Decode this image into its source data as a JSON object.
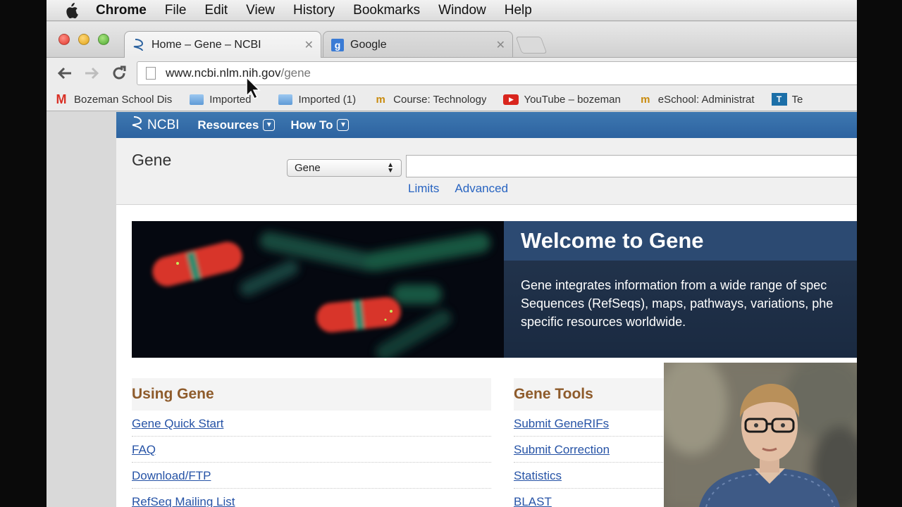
{
  "menubar": {
    "app_name": "Chrome",
    "items": [
      "File",
      "Edit",
      "View",
      "History",
      "Bookmarks",
      "Window",
      "Help"
    ]
  },
  "tabs": [
    {
      "title": "Home – Gene – NCBI",
      "icon": "ncbi-helix-icon",
      "active": true
    },
    {
      "title": "Google",
      "icon": "google-icon",
      "active": false
    }
  ],
  "omnibox": {
    "host": "www.ncbi.nlm.nih.gov",
    "path": "/gene"
  },
  "bookmarks": [
    {
      "label": "Bozeman School Dis",
      "icon": "gmail-icon"
    },
    {
      "label": "Imported",
      "icon": "folder-icon"
    },
    {
      "label": "Imported (1)",
      "icon": "folder-icon"
    },
    {
      "label": "Course: Technology",
      "icon": "course-icon"
    },
    {
      "label": "YouTube – bozeman",
      "icon": "youtube-icon"
    },
    {
      "label": "eSchool: Administrat",
      "icon": "course-icon"
    },
    {
      "label": "Te",
      "icon": "te-icon"
    }
  ],
  "ncbi": {
    "logo": "NCBI",
    "menus": [
      "Resources",
      "How To"
    ]
  },
  "search": {
    "db_title": "Gene",
    "db_selected": "Gene",
    "links": [
      "Limits",
      "Advanced"
    ]
  },
  "hero": {
    "title": "Welcome to Gene",
    "lines": [
      "Gene integrates information from a wide range of spec",
      "Sequences (RefSeqs), maps, pathways, variations, phe",
      "specific resources worldwide."
    ]
  },
  "using_gene": {
    "title": "Using Gene",
    "links": [
      "Gene Quick Start",
      "FAQ",
      "Download/FTP",
      "RefSeq Mailing List"
    ]
  },
  "gene_tools": {
    "title": "Gene Tools",
    "links": [
      "Submit GeneRIFs",
      "Submit Correction",
      "Statistics",
      "BLAST"
    ]
  },
  "colors": {
    "ncbi_blue": "#2d63a0",
    "section_brown": "#8e5b2b",
    "link_blue": "#2653a6"
  }
}
